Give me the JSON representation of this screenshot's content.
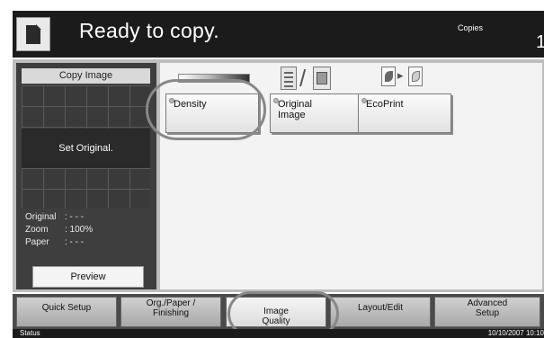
{
  "header": {
    "status_message": "Ready to copy.",
    "copies_label": "Copies",
    "copies_value": "1"
  },
  "preview": {
    "title": "Copy Image",
    "set_original": "Set Original.",
    "rows": [
      {
        "label": "Original",
        "value": ":  - - -"
      },
      {
        "label": "Zoom",
        "value": ": 100%"
      },
      {
        "label": "Paper",
        "value": ":  - - -"
      }
    ],
    "preview_button": "Preview"
  },
  "functions": {
    "density": {
      "label": "Density"
    },
    "original_image": {
      "label_line1": "Original",
      "label_line2": "Image"
    },
    "ecoprint": {
      "label": "EcoPrint"
    }
  },
  "tabs": [
    {
      "line1": "Quick Setup",
      "line2": ""
    },
    {
      "line1": "Org./Paper /",
      "line2": "Finishing"
    },
    {
      "line1": "Image",
      "line2": "Quality"
    },
    {
      "line1": "Layout/Edit",
      "line2": ""
    },
    {
      "line1": "Advanced",
      "line2": "Setup"
    }
  ],
  "statusbar": {
    "status_label": "Status",
    "datetime": "10/10/2007   10:10"
  },
  "icons": {
    "document": "document-icon",
    "original_text": "text-document-icon",
    "original_photo": "photo-document-icon",
    "eco_a": "eco-leaf-icon",
    "eco_b": "eco-leaf-light-icon"
  }
}
